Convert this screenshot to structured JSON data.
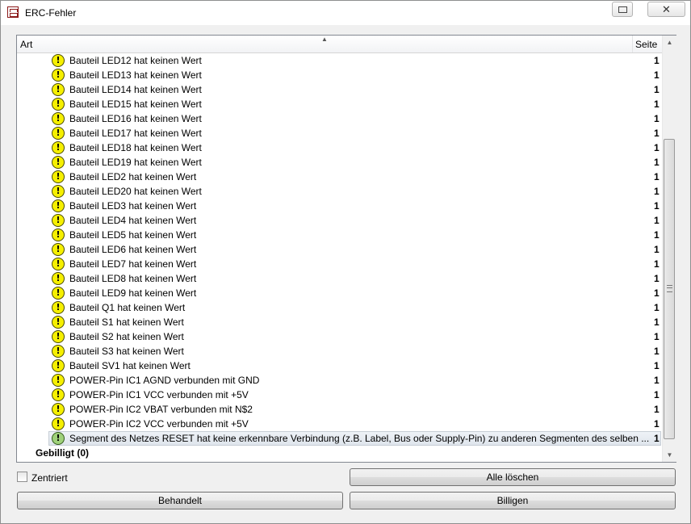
{
  "window": {
    "title": "ERC-Fehler",
    "close_label": "✕"
  },
  "list": {
    "columns": {
      "art": "Art",
      "seite": "Seite"
    },
    "errors": [
      {
        "text": "Bauteil LED12 hat keinen Wert",
        "page": "1",
        "approved": false
      },
      {
        "text": "Bauteil LED13 hat keinen Wert",
        "page": "1",
        "approved": false
      },
      {
        "text": "Bauteil LED14 hat keinen Wert",
        "page": "1",
        "approved": false
      },
      {
        "text": "Bauteil LED15 hat keinen Wert",
        "page": "1",
        "approved": false
      },
      {
        "text": "Bauteil LED16 hat keinen Wert",
        "page": "1",
        "approved": false
      },
      {
        "text": "Bauteil LED17 hat keinen Wert",
        "page": "1",
        "approved": false
      },
      {
        "text": "Bauteil LED18 hat keinen Wert",
        "page": "1",
        "approved": false
      },
      {
        "text": "Bauteil LED19 hat keinen Wert",
        "page": "1",
        "approved": false
      },
      {
        "text": "Bauteil LED2 hat keinen Wert",
        "page": "1",
        "approved": false
      },
      {
        "text": "Bauteil LED20 hat keinen Wert",
        "page": "1",
        "approved": false
      },
      {
        "text": "Bauteil LED3 hat keinen Wert",
        "page": "1",
        "approved": false
      },
      {
        "text": "Bauteil LED4 hat keinen Wert",
        "page": "1",
        "approved": false
      },
      {
        "text": "Bauteil LED5 hat keinen Wert",
        "page": "1",
        "approved": false
      },
      {
        "text": "Bauteil LED6 hat keinen Wert",
        "page": "1",
        "approved": false
      },
      {
        "text": "Bauteil LED7 hat keinen Wert",
        "page": "1",
        "approved": false
      },
      {
        "text": "Bauteil LED8 hat keinen Wert",
        "page": "1",
        "approved": false
      },
      {
        "text": "Bauteil LED9 hat keinen Wert",
        "page": "1",
        "approved": false
      },
      {
        "text": "Bauteil Q1 hat keinen Wert",
        "page": "1",
        "approved": false
      },
      {
        "text": "Bauteil S1 hat keinen Wert",
        "page": "1",
        "approved": false
      },
      {
        "text": "Bauteil S2 hat keinen Wert",
        "page": "1",
        "approved": false
      },
      {
        "text": "Bauteil S3 hat keinen Wert",
        "page": "1",
        "approved": false
      },
      {
        "text": "Bauteil SV1 hat keinen Wert",
        "page": "1",
        "approved": false
      },
      {
        "text": "POWER-Pin IC1 AGND verbunden mit GND",
        "page": "1",
        "approved": false
      },
      {
        "text": "POWER-Pin IC1 VCC verbunden mit +5V",
        "page": "1",
        "approved": false
      },
      {
        "text": "POWER-Pin IC2 VBAT verbunden mit N$2",
        "page": "1",
        "approved": false
      },
      {
        "text": "POWER-Pin IC2 VCC verbunden mit +5V",
        "page": "1",
        "approved": false
      },
      {
        "text": "Segment des Netzes RESET hat keine erkennbare Verbindung (z.B. Label, Bus oder Supply-Pin) zu anderen Segmenten des selben ...",
        "page": "1",
        "approved": true,
        "selected": true
      }
    ],
    "group_approved": "Gebilligt (0)"
  },
  "controls": {
    "centered_label": "Zentriert",
    "centered_checked": false,
    "clear_all_label": "Alle löschen",
    "handled_label": "Behandelt",
    "approve_label": "Billigen"
  },
  "icons": {
    "warning": "warning-icon",
    "approved": "approved-warning-icon"
  }
}
